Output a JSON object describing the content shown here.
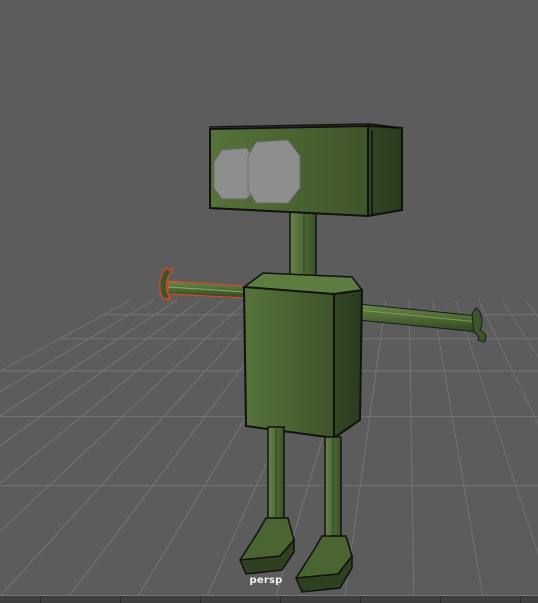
{
  "viewport": {
    "camera_label": "persp",
    "background_color": "#5c5c5c",
    "grid_color": "#737373",
    "selection_color": "#d3462f"
  },
  "robot": {
    "body_color": "#4a6531",
    "body_dark_color": "#2a3a1c",
    "eye_color": "#8e8e8e",
    "outline_color": "#111111",
    "parts": [
      "head",
      "left-eye",
      "right-eye",
      "neck",
      "torso",
      "left-arm",
      "left-hand",
      "right-arm",
      "right-hand",
      "left-leg",
      "right-leg",
      "left-foot",
      "right-foot"
    ]
  }
}
